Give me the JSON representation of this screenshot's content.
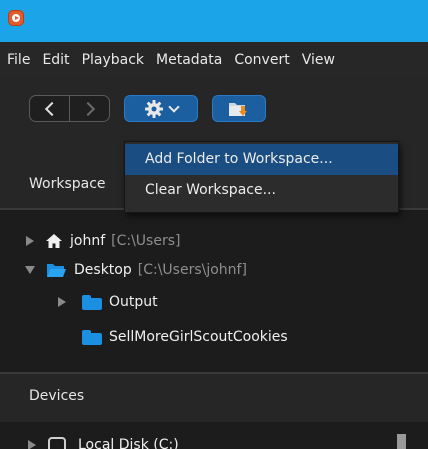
{
  "menubar": {
    "items": [
      "File",
      "Edit",
      "Playback",
      "Metadata",
      "Convert",
      "View"
    ]
  },
  "toolbar": {
    "back_icon": "chevron-left-icon",
    "forward_icon": "chevron-right-icon",
    "settings_icon": "gear-icon",
    "import_icon": "folder-import-icon"
  },
  "workspace": {
    "title": "Workspace"
  },
  "dropdown": {
    "items": [
      "Add Folder to Workspace...",
      "Clear Workspace..."
    ]
  },
  "tree": {
    "home": {
      "name": "johnf",
      "path": "[C:\\Users]"
    },
    "desktop": {
      "name": "Desktop",
      "path": "[C:\\Users\\johnf]"
    },
    "children": [
      "Output",
      "SellMoreGirlScoutCookies"
    ]
  },
  "devices": {
    "title": "Devices",
    "disk_label": "Local Disk (C:)"
  },
  "colors": {
    "titlebar": "#1ba5e8",
    "accent_button": "#1c5fa0",
    "folder": "#1b8fe0",
    "menu_highlight": "#1a4e82"
  }
}
